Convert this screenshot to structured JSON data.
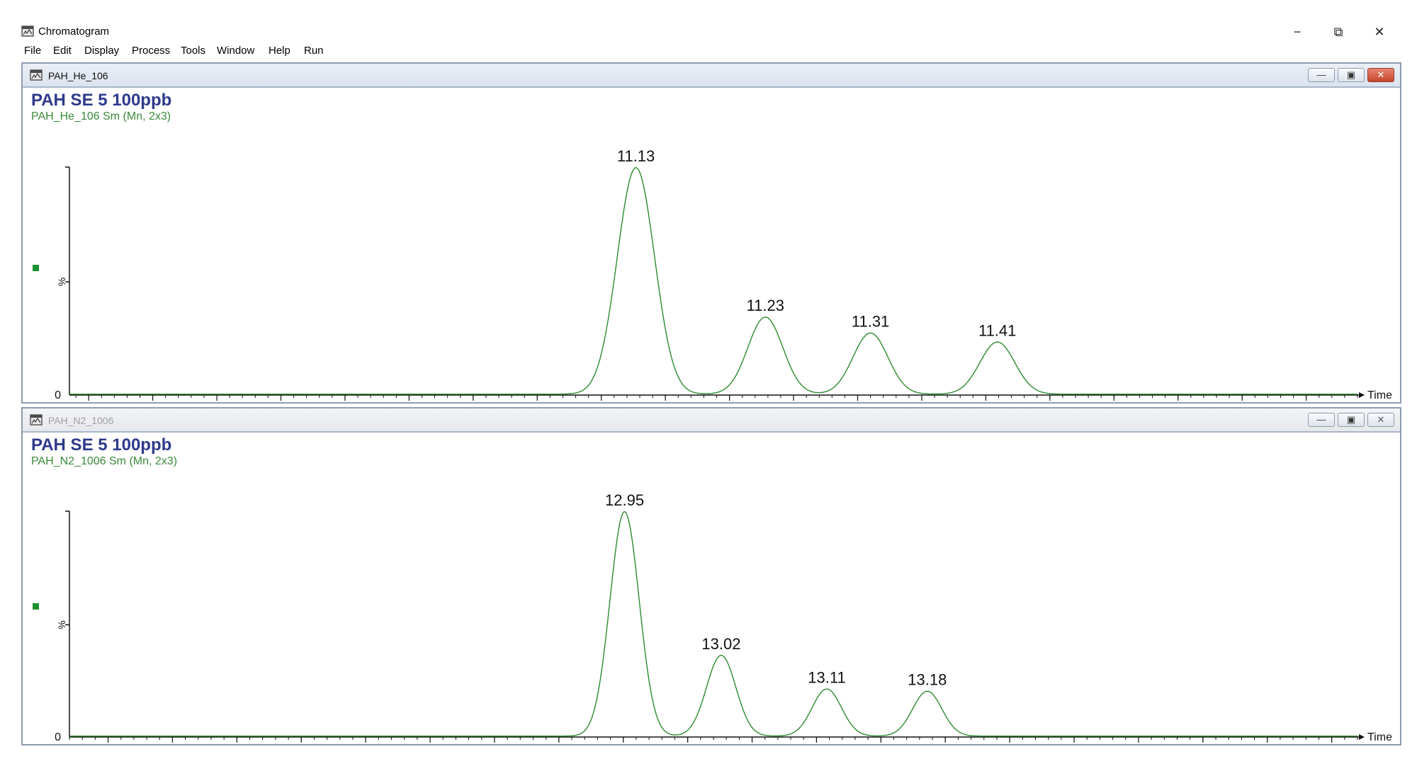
{
  "window": {
    "title": "Chromatogram",
    "icon": "chromatogram-app-icon",
    "controls": {
      "minimize": "−",
      "restore": "⧉",
      "close": "✕"
    }
  },
  "menu": [
    "File",
    "Edit",
    "Display",
    "Process",
    "Tools",
    "Window",
    "Help",
    "Run"
  ],
  "colors": {
    "trace": "#2e8b2e",
    "sample_title": "#2e3a8c",
    "marker": "#1e8f2e",
    "peak_label": "#111111"
  },
  "panels": [
    {
      "window_title": "PAH_He_106",
      "active": true,
      "sample_name": "PAH SE 5 100ppb",
      "trace_name": "PAH_He_106 Sm (Mn, 2x3)",
      "y_axis_label": "%",
      "y_zero_label": "0",
      "x_axis_label": "Time"
    },
    {
      "window_title": "PAH_N2_1006",
      "active": false,
      "sample_name": "PAH SE 5 100ppb",
      "trace_name": "PAH_N2_1006 Sm (Mn, 2x3)",
      "y_axis_label": "%",
      "y_zero_label": "0",
      "x_axis_label": "Time"
    }
  ],
  "chart_data": [
    {
      "type": "line",
      "title": "PAH SE 5 100ppb",
      "series": [
        {
          "name": "PAH_He_106 Sm (Mn, 2x3)"
        }
      ],
      "xlabel": "Time",
      "ylabel": "%",
      "xlim": [
        10.685,
        11.69
      ],
      "ylim": [
        0,
        100
      ],
      "x_ticks": [
        "10.70",
        "10.75",
        "10.80",
        "10.85",
        "10.90",
        "10.95",
        "11.00",
        "11.05",
        "11.10",
        "11.15",
        "11.20",
        "11.25",
        "11.30",
        "11.35",
        "11.40",
        "11.45",
        "11.50",
        "11.55",
        "11.60",
        "11.65"
      ],
      "peaks": [
        {
          "label": "11.13",
          "time": 11.127,
          "height": 100,
          "width": 0.032
        },
        {
          "label": "11.23",
          "time": 11.228,
          "height": 34,
          "width": 0.03
        },
        {
          "label": "11.31",
          "time": 11.31,
          "height": 27,
          "width": 0.03
        },
        {
          "label": "11.41",
          "time": 11.409,
          "height": 23,
          "width": 0.03
        }
      ],
      "grid": false
    },
    {
      "type": "line",
      "title": "PAH SE 5 100ppb",
      "series": [
        {
          "name": "PAH_N2_1006 Sm (Mn, 2x3)"
        }
      ],
      "xlabel": "Time",
      "ylabel": "%",
      "xlim": [
        12.52,
        13.52
      ],
      "ylim": [
        0,
        100
      ],
      "x_ticks": [
        "12.55",
        "12.60",
        "12.65",
        "12.70",
        "12.75",
        "12.80",
        "12.85",
        "12.90",
        "12.95",
        "13.00",
        "13.05",
        "13.10",
        "13.15",
        "13.20",
        "13.25",
        "13.30",
        "13.35",
        "13.40",
        "13.45",
        "13.50"
      ],
      "peaks": [
        {
          "label": "12.95",
          "time": 12.951,
          "height": 100,
          "width": 0.025
        },
        {
          "label": "13.02",
          "time": 13.026,
          "height": 36,
          "width": 0.025
        },
        {
          "label": "13.11",
          "time": 13.108,
          "height": 21,
          "width": 0.025
        },
        {
          "label": "13.18",
          "time": 13.186,
          "height": 20,
          "width": 0.025
        }
      ],
      "grid": false
    }
  ]
}
